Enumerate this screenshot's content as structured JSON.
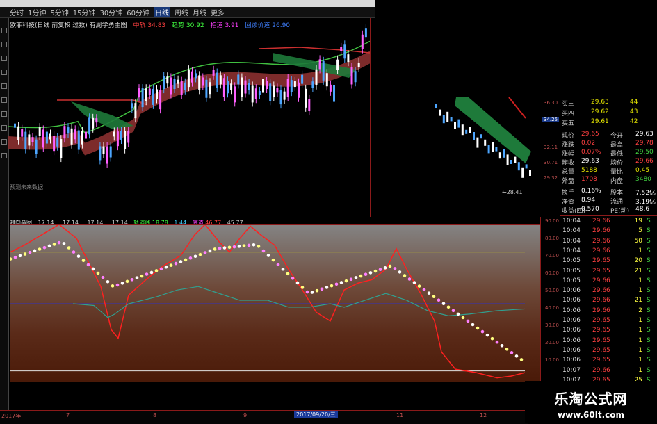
{
  "toolbar": {
    "periods": [
      "分时",
      "1分钟",
      "5分钟",
      "15分钟",
      "30分钟",
      "60分钟",
      "日线",
      "周线",
      "月线",
      "更多"
    ],
    "active_period": "日线"
  },
  "kline": {
    "title": "欧菲科技(日线 前复权 过数) 有周学勇主图",
    "ma": [
      {
        "label": "中轨",
        "value": "34.83",
        "color": "#ff4040"
      },
      {
        "label": "趋势",
        "value": "30.92",
        "color": "#40ff40"
      },
      {
        "label": "指道",
        "value": "3.91",
        "color": "#ff40ff"
      },
      {
        "label": "回顾价道",
        "value": "26.90",
        "color": "#4080ff"
      }
    ],
    "predict_label": "预测未来数据"
  },
  "indicator": {
    "name": "趋向晶图",
    "values": [
      "17.14",
      "17.14",
      "17.14",
      "17.14"
    ],
    "line_label": "轨道线",
    "line_value": "18.78",
    "v5": "1.44",
    "v6_label": "底道",
    "v6": "46.77",
    "v7": "45.77",
    "yticks": [
      "90.00",
      "80.00",
      "70.00",
      "60.00",
      "50.00",
      "40.00",
      "30.00",
      "20.00",
      "10.00"
    ],
    "hlines": {
      "yellow": 80,
      "blue": 50,
      "white": 11
    }
  },
  "xaxis": {
    "labels": [
      "2017年",
      "7",
      "8",
      "9",
      "10",
      "11",
      "12"
    ],
    "cursor_date": "2017/09/20/三"
  },
  "mini_chart": {
    "yticks": [
      "36.30",
      "34.25",
      "32.11",
      "30.71",
      "29.32"
    ],
    "highlight": "34.25",
    "low_label": "28.41"
  },
  "quote": {
    "orderbook": [
      {
        "label": "买三",
        "price": "29.63",
        "vol": "44"
      },
      {
        "label": "买四",
        "price": "29.62",
        "vol": "43"
      },
      {
        "label": "买五",
        "price": "29.61",
        "vol": "42"
      }
    ],
    "stats": [
      {
        "l1": "现价",
        "v1": "29.65",
        "l2": "今开",
        "v2": "29.63",
        "c1": "red",
        "c2": "wht"
      },
      {
        "l1": "涨跌",
        "v1": "0.02",
        "l2": "最高",
        "v2": "29.78",
        "c1": "red",
        "c2": "red"
      },
      {
        "l1": "涨幅",
        "v1": "0.07%",
        "l2": "最低",
        "v2": "29.50",
        "c1": "red",
        "c2": "grn"
      },
      {
        "l1": "昨收",
        "v1": "29.63",
        "l2": "均价",
        "v2": "29.66",
        "c1": "wht",
        "c2": "red"
      },
      {
        "l1": "总量",
        "v1": "5188",
        "l2": "量比",
        "v2": "0.45",
        "c1": "yel",
        "c2": "yel"
      },
      {
        "l1": "外盘",
        "v1": "1708",
        "l2": "内盘",
        "v2": "3480",
        "c1": "red",
        "c2": "grn"
      }
    ],
    "fundamentals": [
      {
        "l1": "换手",
        "v1": "0.16%",
        "l2": "股本",
        "v2": "7.52亿"
      },
      {
        "l1": "净资",
        "v1": "8.94",
        "l2": "流通",
        "v2": "3.19亿"
      },
      {
        "l1": "收益(四)",
        "v1": "0.570",
        "l2": "PE(动)",
        "v2": "48.6"
      }
    ],
    "ticks": [
      {
        "time": "10:04",
        "price": "29.66",
        "vol": "19",
        "side": "S"
      },
      {
        "time": "10:04",
        "price": "29.66",
        "vol": "5",
        "side": "S"
      },
      {
        "time": "10:04",
        "price": "29.66",
        "vol": "50",
        "side": "S"
      },
      {
        "time": "10:04",
        "price": "29.66",
        "vol": "1",
        "side": "S"
      },
      {
        "time": "10:05",
        "price": "29.65",
        "vol": "20",
        "side": "S"
      },
      {
        "time": "10:05",
        "price": "29.65",
        "vol": "21",
        "side": "S"
      },
      {
        "time": "10:05",
        "price": "29.66",
        "vol": "1",
        "side": "S"
      },
      {
        "time": "10:06",
        "price": "29.66",
        "vol": "1",
        "side": "S"
      },
      {
        "time": "10:06",
        "price": "29.66",
        "vol": "21",
        "side": "S"
      },
      {
        "time": "10:06",
        "price": "29.66",
        "vol": "2",
        "side": "S"
      },
      {
        "time": "10:06",
        "price": "29.65",
        "vol": "1",
        "side": "S"
      },
      {
        "time": "10:06",
        "price": "29.65",
        "vol": "1",
        "side": "S"
      },
      {
        "time": "10:06",
        "price": "29.65",
        "vol": "1",
        "side": "S"
      },
      {
        "time": "10:06",
        "price": "29.65",
        "vol": "1",
        "side": "S"
      },
      {
        "time": "10:06",
        "price": "29.65",
        "vol": "1",
        "side": "S"
      },
      {
        "time": "10:07",
        "price": "29.66",
        "vol": "1",
        "side": "S"
      },
      {
        "time": "10:07",
        "price": "29.65",
        "vol": "25",
        "side": "S"
      }
    ]
  },
  "watermark": {
    "title": "乐淘公式网",
    "url": "www.60lt.com"
  }
}
